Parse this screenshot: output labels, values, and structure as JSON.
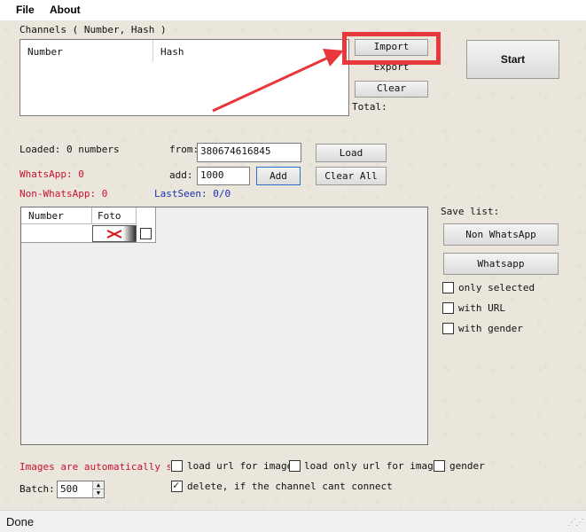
{
  "menu": {
    "file": "File",
    "about": "About"
  },
  "channels": {
    "group_label": "Channels ( Number, Hash )",
    "col_number": "Number",
    "col_hash": "Hash",
    "import_label": "Import",
    "export_label": "Export",
    "clear_label": "Clear",
    "total_label": "Total:"
  },
  "start_label": "Start",
  "load": {
    "loaded_text": "Loaded: 0 numbers",
    "whatsapp_text": "WhatsApp: 0",
    "non_whatsapp_text": "Non-WhatsApp: 0",
    "lastseen_text": "LastSeen: 0/0",
    "from_label": "from:",
    "from_value": "380674616845",
    "add_label": "add:",
    "add_value": "1000",
    "add_button": "Add",
    "load_button": "Load",
    "clear_all_button": "Clear All"
  },
  "grid": {
    "col_number": "Number",
    "col_foto": "Foto"
  },
  "save": {
    "title": "Save list:",
    "non_whatsapp_button": "Non WhatsApp",
    "whatsapp_button": "Whatsapp",
    "only_selected": "only selected",
    "with_url": "with URL",
    "with_gender": "with gender"
  },
  "options": {
    "images_saved_text": "Images are automatically save",
    "load_url_images": "load url for images",
    "load_only_url_images": "load only url for images",
    "gender": "gender",
    "delete_channel": "delete, if the channel cant connect",
    "delete_channel_checked": true,
    "batch_label": "Batch:",
    "batch_value": "500"
  },
  "status": {
    "text": "Done"
  },
  "colors": {
    "annotation_red": "#e8383d",
    "label_red": "#c8102e",
    "label_blue": "#1a30b0"
  },
  "icons": {
    "foto_placeholder": "broken-image-x-icon",
    "resize_grip": "resize-grip-icon"
  }
}
